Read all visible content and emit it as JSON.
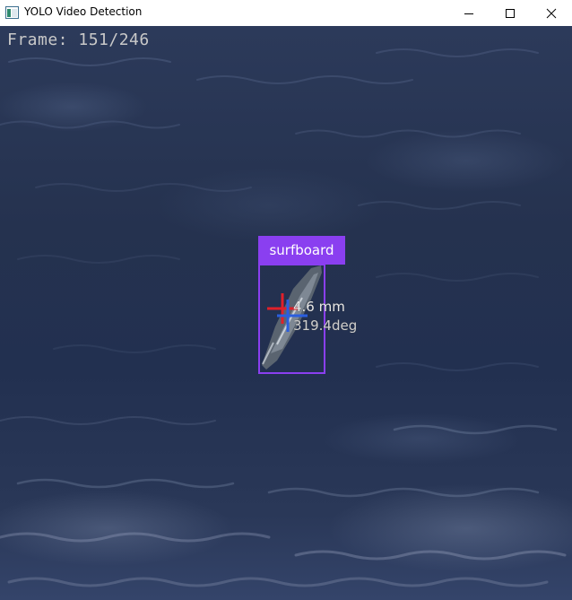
{
  "window": {
    "title": "YOLO Video Detection",
    "icon": "app-window-icon",
    "controls": [
      "minimize-icon",
      "maximize-icon",
      "close-icon"
    ]
  },
  "video": {
    "frame_counter": "Frame: 151/246",
    "detection": {
      "label": "surfboard",
      "box_color": "#8a3ff0"
    },
    "measurements": {
      "distance": "4.6 mm",
      "angle": "319.4deg"
    },
    "crosshair_colors": {
      "primary": "#e0202a",
      "secondary": "#2a5ee0"
    }
  }
}
